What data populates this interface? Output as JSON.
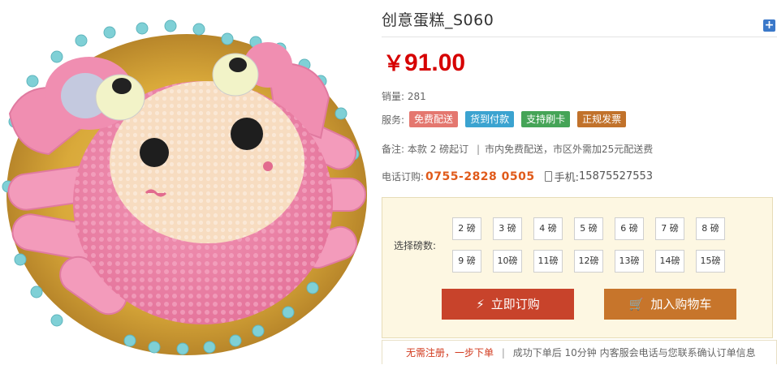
{
  "product": {
    "title": "创意蛋糕_S060",
    "price_symbol": "￥",
    "price": "91.00"
  },
  "sales": {
    "label": "销量:",
    "value": "281"
  },
  "services": {
    "label": "服务:",
    "badges": [
      {
        "text": "免费配送",
        "color": "#e4776f"
      },
      {
        "text": "货到付款",
        "color": "#3ba3d0"
      },
      {
        "text": "支持刷卡",
        "color": "#45a457"
      },
      {
        "text": "正规发票",
        "color": "#c1722b"
      }
    ]
  },
  "note": {
    "label": "备注:",
    "part1": "本款 2 磅起订",
    "sep": "|",
    "part2": "市内免费配送，市区外需加25元配送费"
  },
  "phone": {
    "label": "电话订购:",
    "number": "0755-2828 0505",
    "mobile_label": "手机:",
    "mobile": "15875527553"
  },
  "weight_select": {
    "label": "选择磅数:",
    "row1": [
      "2 磅",
      "3 磅",
      "4 磅",
      "5 磅",
      "6 磅",
      "7 磅",
      "8 磅"
    ],
    "row2": [
      "9 磅",
      "10磅",
      "11磅",
      "12磅",
      "13磅",
      "14磅",
      "15磅"
    ]
  },
  "buttons": {
    "order": "立即订购",
    "cart": "加入购物车"
  },
  "footer": {
    "highlight": "无需注册，一步下单",
    "sep": "|",
    "text": "成功下单后 10分钟 内客服会电话与您联系确认订单信息"
  },
  "icons": {
    "order_icon": "lightning-icon",
    "cart_icon": "cart-icon",
    "mobile_icon": "mobile-phone-icon",
    "plus_icon": "plus-icon"
  }
}
